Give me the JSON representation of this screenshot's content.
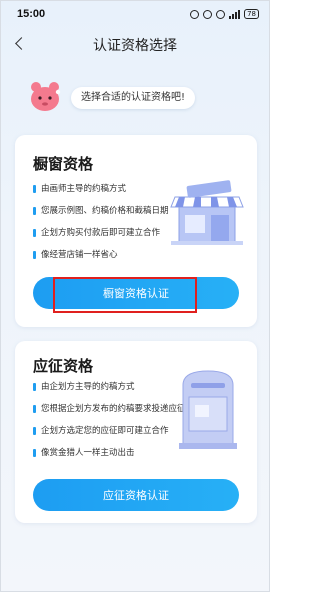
{
  "status_bar": {
    "time": "15:00",
    "battery": "78"
  },
  "nav": {
    "title": "认证资格选择"
  },
  "intro": {
    "text": "选择合适的认证资格吧!"
  },
  "cards": [
    {
      "title": "橱窗资格",
      "features": [
        "由画师主导的约稿方式",
        "您展示例图、约稿价格和截稿日期",
        "企划方购买付款后即可建立合作",
        "像经营店铺一样省心"
      ],
      "button_label": "橱窗资格认证",
      "illustration_icon": "storefront-icon"
    },
    {
      "title": "应征资格",
      "features": [
        "由企划方主导的约稿方式",
        "您根据企划方发布的约稿要求投递应征",
        "企划方选定您的应征即可建立合作",
        "像赏金猎人一样主动出击"
      ],
      "button_label": "应征资格认证",
      "illustration_icon": "mailbox-icon"
    }
  ],
  "colors": {
    "accent": "#1f9df0",
    "highlight": "#e0201e",
    "background": "#eaf2fb"
  }
}
